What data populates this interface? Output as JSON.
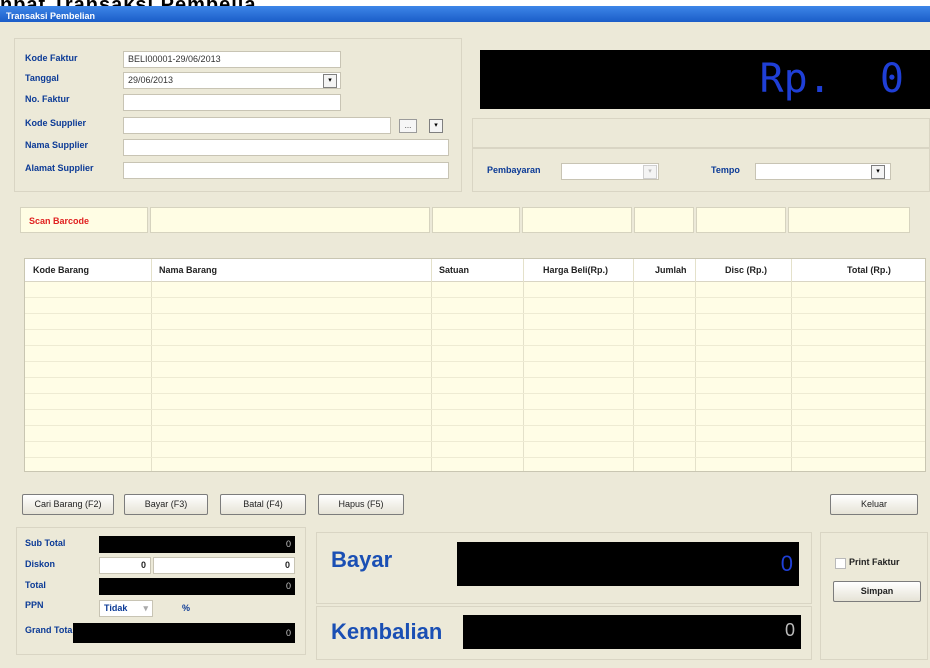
{
  "page_heading": "npat Transaksi Pembelia",
  "window": {
    "title": "Transaksi Pembelian"
  },
  "header_form": {
    "kode_faktur_label": "Kode Faktur",
    "kode_faktur_value": "BELI00001-29/06/2013",
    "tanggal_label": "Tanggal",
    "tanggal_value": "29/06/2013",
    "no_faktur_label": "No. Faktur",
    "kode_supplier_label": "Kode Supplier",
    "nama_supplier_label": "Nama Supplier",
    "alamat_supplier_label": "Alamat Supplier"
  },
  "display": {
    "total_text": "Rp.  0"
  },
  "payment": {
    "pembayaran_label": "Pembayaran",
    "tempo_label": "Tempo"
  },
  "scan": {
    "label": "Scan Barcode"
  },
  "table": {
    "columns": [
      "Kode Barang",
      "Nama Barang",
      "Satuan",
      "Harga Beli(Rp.)",
      "Jumlah",
      "Disc (Rp.)",
      "Total (Rp.)"
    ]
  },
  "actions": {
    "cari_barang": "Cari Barang (F2)",
    "bayar": "Bayar (F3)",
    "batal": "Batal (F4)",
    "hapus": "Hapus (F5)",
    "keluar": "Keluar"
  },
  "summary": {
    "sub_total_label": "Sub Total",
    "sub_total_value": "0",
    "diskon_label": "Diskon",
    "diskon_percent": "0",
    "diskon_value": "0",
    "total_label": "Total",
    "total_value": "0",
    "ppn_label": "PPN",
    "ppn_option": "Tidak",
    "ppn_percent_sign": "%",
    "grand_total_label": "Grand Total",
    "grand_total_value": "0"
  },
  "pay": {
    "bayar_label": "Bayar",
    "bayar_value": "0",
    "kembalian_label": "Kembalian",
    "kembalian_value": "0"
  },
  "print": {
    "checkbox_label": "Print Faktur",
    "simpan": "Simpan"
  },
  "colors": {
    "titlebar": "#1b5dc8",
    "label_blue": "#0b3a96",
    "display_text": "#1f3fd6",
    "scan_red": "#e02020",
    "grid_bg": "#fffde6"
  }
}
